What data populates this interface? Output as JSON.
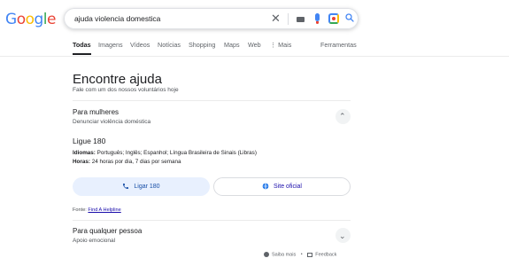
{
  "logo": {
    "text": "Google"
  },
  "search": {
    "query": "ajuda violencia domestica"
  },
  "tabs": [
    {
      "label": "Todas",
      "active": true
    },
    {
      "label": "Imagens"
    },
    {
      "label": "Vídeos"
    },
    {
      "label": "Notícias"
    },
    {
      "label": "Shopping"
    },
    {
      "label": "Maps"
    },
    {
      "label": "Web"
    },
    {
      "label": "⋮ Mais"
    }
  ],
  "tools_label": "Ferramentas",
  "card": {
    "title": "Encontre ajuda",
    "subtitle": "Fale com um dos nossos voluntários hoje",
    "section1": {
      "title": "Para mulheres",
      "desc": "Denunciar violência doméstica",
      "phone": "Ligue 180",
      "languages_label": "Idiomas:",
      "languages": " Português; Inglês; Espanhol; Língua Brasileira de Sinais (Libras)",
      "hours_label": "Horas:",
      "hours": " 24 horas por dia, 7 dias por semana",
      "call_button": "Ligar 180",
      "site_button": "Site oficial",
      "source_label": "Fonte: ",
      "source_link": "Find A Helpline"
    },
    "section2": {
      "title": "Para qualquer pessoa",
      "desc": "Apoio emocional"
    }
  },
  "footer": {
    "learn_more": "Saiba mais",
    "separator": "•",
    "feedback": "Feedback"
  },
  "colors": {
    "link": "#1a0dab",
    "accent_blue": "#4285f4",
    "call_bg": "#e8f0fe"
  }
}
